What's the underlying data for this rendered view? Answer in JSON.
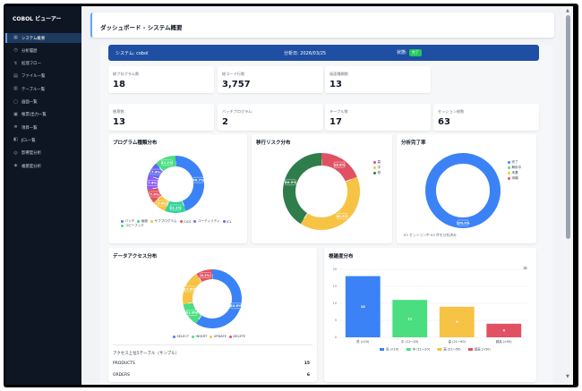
{
  "app": {
    "title": "COBOL ビューアー"
  },
  "sidebar": {
    "items": [
      {
        "label": "システム概要",
        "icon": "dashboard-icon",
        "active": true
      },
      {
        "label": "分析履歴",
        "icon": "history-icon"
      },
      {
        "label": "処理フロー",
        "icon": "flow-icon"
      },
      {
        "label": "ファイル一覧",
        "icon": "file-icon"
      },
      {
        "label": "テーブル一覧",
        "icon": "table-icon"
      },
      {
        "label": "画面一覧",
        "icon": "screen-icon"
      },
      {
        "label": "帳票/出力一覧",
        "icon": "report-icon"
      },
      {
        "label": "項目一覧",
        "icon": "list-icon"
      },
      {
        "label": "JCL一覧",
        "icon": "jcl-icon"
      },
      {
        "label": "影響度分析",
        "icon": "impact-icon"
      },
      {
        "label": "複雑度分析",
        "icon": "complexity-icon"
      }
    ]
  },
  "header": {
    "title": "ダッシュボード - システム概要"
  },
  "banner": {
    "system": "システム: cobol",
    "date": "分析日: 2026/03/25",
    "status_label": "状態:",
    "status_badge": "完了"
  },
  "stats": [
    {
      "label": "総プログラム数",
      "value": "18"
    },
    {
      "label": "総コード行数",
      "value": "3,757"
    },
    {
      "label": "画面種類数",
      "value": "13"
    },
    {
      "label": "帳票数",
      "value": "13"
    },
    {
      "label": "バッチプログラム",
      "value": "2"
    },
    {
      "label": "テーブル数",
      "value": "17"
    },
    {
      "label": "セッション総数",
      "value": "63"
    }
  ],
  "colors": {
    "blue": "#3b82f6",
    "green": "#4ade80",
    "yellow": "#f6c344",
    "red": "#e05263",
    "purple": "#8b5cf6",
    "teal": "#34d399",
    "darkgreen": "#2f7d4a",
    "banner": "#1f4fa3"
  },
  "chart_data": [
    {
      "type": "pie",
      "title": "プログラム種類分布",
      "categories": [
        "バッチ",
        "画面",
        "サブプログラム",
        "CICS",
        "ユーティリティ",
        "JCL",
        "コピーブック"
      ],
      "values": [
        40.7,
        11.1,
        7.4,
        7.4,
        7.4,
        7.4,
        11.1
      ],
      "labels": [
        "40.7%",
        "11.1%",
        "7.4%",
        "7.4%",
        "7.4%",
        "7.4%",
        "11.1%"
      ]
    },
    {
      "type": "pie",
      "title": "移行リスク分布",
      "categories": [
        "高",
        "中",
        "低"
      ],
      "values": [
        18.8,
        40.3,
        40.9
      ],
      "labels": [
        "18.8%",
        "40.3%",
        "40.9%"
      ]
    },
    {
      "type": "pie",
      "title": "分析完了率",
      "categories": [
        "完了",
        "解析中",
        "未着",
        "待機"
      ],
      "values": [
        100,
        0,
        0,
        0
      ],
      "labels": [
        "100.0%"
      ],
      "footnote": "63 セッション中 63 件を分析済み"
    },
    {
      "type": "pie",
      "title": "データアクセス分布",
      "categories": [
        "SELECT",
        "INSERT",
        "UPDATE",
        "DELETE"
      ],
      "values": [
        54.6,
        11.8,
        17.6,
        8.2
      ],
      "labels": [
        "54.6%",
        "11.8%",
        "17.6%",
        "8.2%"
      ]
    },
    {
      "type": "bar",
      "title": "複雑度分布",
      "categories": [
        "低 (<10)",
        "中 (11〜20)",
        "高 (21〜50)",
        "超高 (>50)"
      ],
      "values": [
        18,
        11,
        9,
        4
      ],
      "yticks": [
        "20",
        "15",
        "10",
        "5",
        "0"
      ],
      "ylim": [
        0,
        20
      ],
      "legend": [
        "低 (<10)",
        "中 (11〜20)",
        "高 (21〜50)",
        "超高 (>50)"
      ]
    }
  ],
  "access_table": {
    "title": "アクセス上位5テーブル（サンプル）",
    "rows": [
      {
        "name": "PRODUCTS",
        "count": "15"
      },
      {
        "name": "ORDERS",
        "count": "6"
      }
    ]
  }
}
